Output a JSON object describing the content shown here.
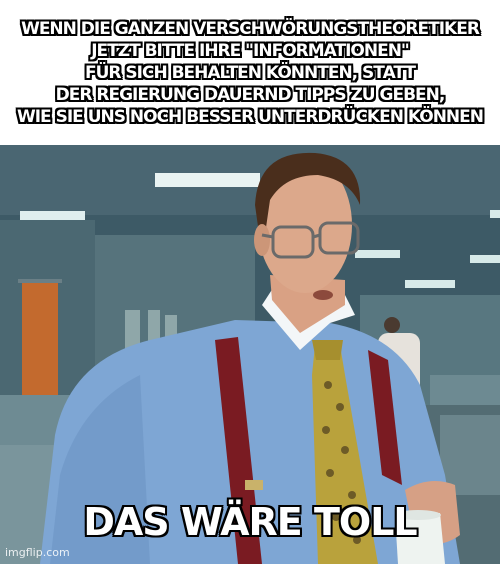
{
  "meme": {
    "top_text": "WENN DIE GANZEN VERSCHWÖRUNGSTHEORETIKER\nJETZT BITTE IHRE \"INFORMATIONEN\"\nFÜR SICH BEHALTEN KÖNNTEN, STATT\nDER REGIERUNG DAUERND TIPPS ZU GEBEN,\nWIE SIE UNS NOCH BESSER UNTERDRÜCKEN KÖNNEN",
    "bottom_text": "DAS WÄRE TOLL",
    "watermark": "imgflip.com"
  },
  "colors": {
    "office_wall": "#3f5b66",
    "shirt": "#7fa6d2",
    "suspenders": "#7a1b22",
    "tie": "#b7a13a",
    "caption_text": "#ffffff",
    "caption_outline": "#000000"
  }
}
